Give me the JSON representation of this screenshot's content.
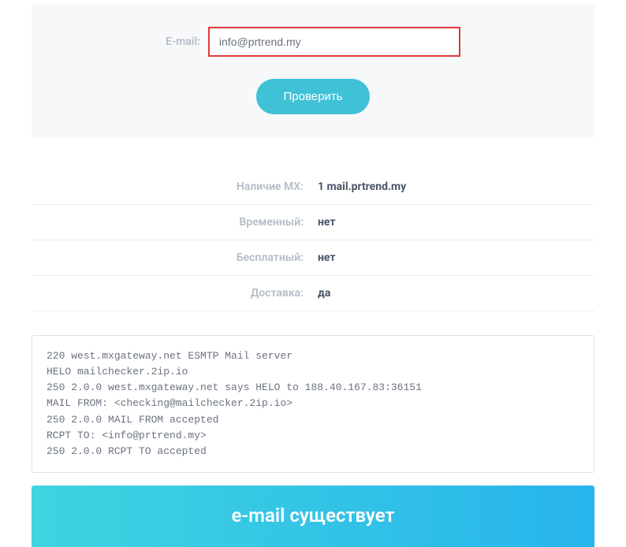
{
  "form": {
    "label": "E-mail:",
    "email_value": "info@prtrend.my",
    "check_button": "Проверить"
  },
  "results": [
    {
      "label": "Наличие MX:",
      "value": "1 mail.prtrend.my"
    },
    {
      "label": "Временный:",
      "value": "нет"
    },
    {
      "label": "Бесплатный:",
      "value": "нет"
    },
    {
      "label": "Доставка:",
      "value": "да"
    }
  ],
  "log": "220 west.mxgateway.net ESMTP Mail server\nHELO mailchecker.2ip.io\n250 2.0.0 west.mxgateway.net says HELO to 188.40.167.83:36151\nMAIL FROM: <checking@mailchecker.2ip.io>\n250 2.0.0 MAIL FROM accepted\nRCPT TO: <info@prtrend.my>\n250 2.0.0 RCPT TO accepted",
  "banner": "e-mail существует"
}
